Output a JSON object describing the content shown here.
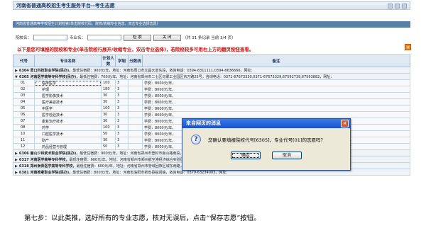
{
  "window": {
    "title": "河南省普通高校招生考生服务平台--考生志愿"
  },
  "subbar": {
    "text": "河南省普通高等学校招生计划检索(单击院校代码、院校/收缩专业信息，双击专业选择志愿)"
  },
  "search": {
    "school_label": "院校名：",
    "school_value": "",
    "major_label": "专业名：",
    "major_value": "",
    "search_button": "检  索",
    "close_button": "关  闭",
    "record_info": "（共 31 条记录  当前 3/4 页）"
  },
  "notice": "以下是您可填报的院校和专业(单击院校行展开/收缩专业，双击专业选择)，若院校较多可用右上方的翻页按钮查看。",
  "table": {
    "headers": [
      "代号",
      "专业名称",
      "计划人数",
      "学制",
      "分数线",
      "备注"
    ],
    "schools_top": [
      {
        "code": "6304",
        "name": "周口科技职业学院(民办)",
        "detail": "最低住宿费：900元/年，地址：河南省周口市文昌大道东段，咨询电话：0394-8311111,0394-8636666，网址："
      },
      {
        "code": "6305",
        "name": "河南医学高等专科学校(民办)",
        "detail": "最低住宿费：700元/年，地址：河南省郑州市二七区马寨工业园区京万路25号，咨询电话：0371-67673330,0371-67673329,67592739,67593882，网址："
      }
    ],
    "majors": [
      {
        "code": "01",
        "name": "临床医学",
        "plan": "100",
        "years": "3",
        "remark": "学费：8000元/年，"
      },
      {
        "code": "02",
        "name": "护理",
        "plan": "180",
        "years": "3",
        "remark": "学费：8000元/年，"
      },
      {
        "code": "03",
        "name": "医学影像技术",
        "plan": "30",
        "years": "3",
        "remark": "学费：8000元/年，"
      },
      {
        "code": "04",
        "name": "医疗美容技术",
        "plan": "30",
        "years": "3",
        "remark": "学费：8000元/年，"
      },
      {
        "code": "05",
        "name": "中医学",
        "plan": "100",
        "years": "3",
        "remark": "学费：8000元/年，"
      },
      {
        "code": "06",
        "name": "医学检验技术",
        "plan": "30",
        "years": "3",
        "remark": "学费：8000元/年，"
      },
      {
        "code": "07",
        "name": "康复治疗技术",
        "plan": "30",
        "years": "3",
        "remark": "学费：8000元/年，"
      },
      {
        "code": "08",
        "name": "药学",
        "plan": "100",
        "years": "3",
        "remark": "学费：8000元/年，"
      },
      {
        "code": "10",
        "name": "口腔医学技术",
        "plan": "50",
        "years": "3",
        "remark": "学费：8000元/年，"
      },
      {
        "code": "11",
        "name": "助产",
        "plan": "30",
        "years": "3",
        "remark": "学费：8000元/年，"
      },
      {
        "code": "12",
        "name": "药品经营与管理",
        "plan": "50",
        "years": "3",
        "remark": "学费：8000元/年，"
      }
    ],
    "schools_bottom": [
      {
        "code": "6306",
        "name": "嵩山少林武术职业学院(民办)",
        "detail": "最低住宿费：900元/年，地址：河南省郑州市登封市嵩山路南段，咨询电话：0371-62809555,0371-62809556，网址："
      },
      {
        "code": "6317",
        "name": "河南医学高等专科学校",
        "detail": "最低住宿费：600元/年，地址：河南省郑州市郑州航空港经济综合实验区，咨询电话："
      },
      {
        "code": "6318",
        "name": "郑州澍青医学高等专科学校",
        "detail": "最低住宿费：600元/年，地址：河南省郑州市管城回族区城东南路，咨询电话：0371-62576816，网址："
      },
      {
        "code": "6381",
        "name": "河南推拿职业学院(民办)",
        "detail": "最低住宿费：800元/年，地址：河南省洛阳市新安县磁涧镇，咨询电话：0379-63234003，网址："
      }
    ]
  },
  "dialog": {
    "title": "来自网页的消息",
    "message": "您确认要填报院校代号[6305]，专业代号[01]的志愿吗？",
    "ok": "确定",
    "cancel": "取消"
  },
  "caption": "第七步：以此类推，选好所有的专业志愿，核对无误后，点击“保存志愿”按钮。",
  "colors": {
    "notice": "#cc1111",
    "header_bg": "#dfe9f3",
    "dialog_title": "#1752d1"
  }
}
